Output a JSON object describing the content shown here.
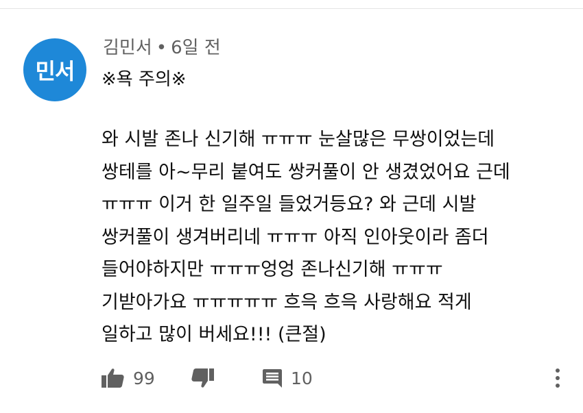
{
  "comment": {
    "avatar_text": "민서",
    "avatar_color": "#1e88d8",
    "author": "김민서",
    "separator": "•",
    "time": "6일 전",
    "warning": "※욕 주의※",
    "body_lines": [
      "와 시발 존나 신기해 ㅠㅠㅠ 눈살많은 무쌍이었는데",
      "쌍테를 아~무리 붙여도 쌍커풀이 안 생겼었어요 근데",
      "ㅠㅠㅠ 이거 한 일주일 들었거등요? 와 근데 시발",
      "쌍커풀이 생겨버리네 ㅠㅠㅠ 아직 인아웃이라 좀더",
      "들어야하지만 ㅠㅠㅠ엉엉 존나신기해 ㅠㅠㅠ",
      "기받아가요 ㅠㅠㅠㅠㅠ 흐윽 흐윽 사랑해요 적게",
      "일하고 많이 버세요!!! (큰절)"
    ],
    "like_count": "99",
    "reply_count": "10",
    "icons": {
      "like": "thumbs-up-icon",
      "dislike": "thumbs-down-icon",
      "reply": "comment-icon",
      "more": "more-vert-icon"
    }
  }
}
